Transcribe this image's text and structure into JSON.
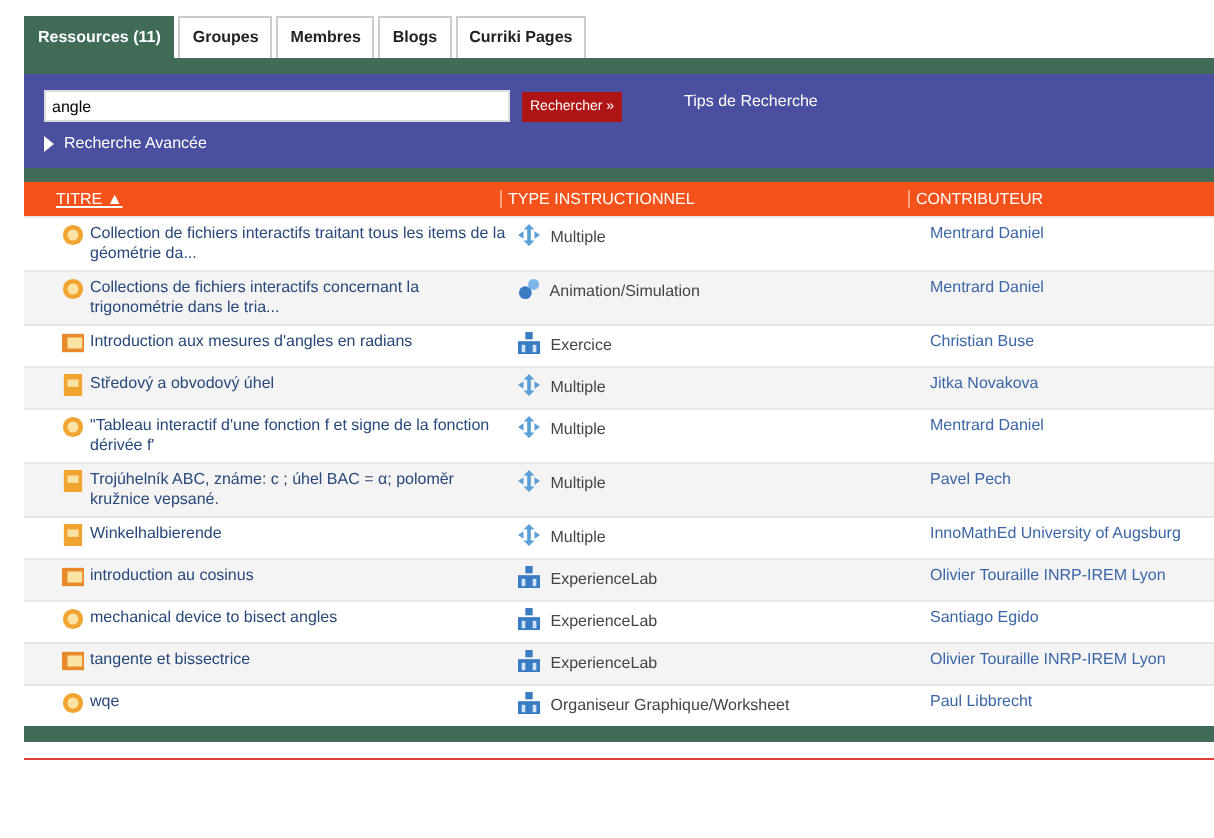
{
  "tabs": [
    {
      "label": "Ressources (11)",
      "selected": true
    },
    {
      "label": "Groupes",
      "selected": false
    },
    {
      "label": "Membres",
      "selected": false
    },
    {
      "label": "Blogs",
      "selected": false
    },
    {
      "label": "Curriki Pages",
      "selected": false
    }
  ],
  "search": {
    "value": "angle",
    "button": "Rechercher »",
    "tips": "Tips de Recherche",
    "advanced": "Recherche Avancée"
  },
  "table": {
    "columns": [
      "TITRE ▲",
      "TYPE INSTRUCTIONNEL",
      "CONTRIBUTEUR"
    ],
    "rows": [
      {
        "kind": "interactive",
        "title": "Collection de fichiers interactifs traitant tous les items de la géométrie da...",
        "type": {
          "kind": "multiple",
          "label": "Multiple"
        },
        "contributor": "Mentrard Daniel"
      },
      {
        "kind": "interactive",
        "title": "Collections de fichiers interactifs concernant la trigonométrie dans le tria...",
        "type": {
          "kind": "animation",
          "label": "Animation/Simulation"
        },
        "contributor": "Mentrard Daniel"
      },
      {
        "kind": "book",
        "title": "Introduction aux mesures d'angles en radians",
        "type": {
          "kind": "blocks",
          "label": "Exercice"
        },
        "contributor": "Christian Buse"
      },
      {
        "kind": "document",
        "title": "Středový a obvodový úhel",
        "type": {
          "kind": "multiple",
          "label": "Multiple"
        },
        "contributor": "Jitka Novakova"
      },
      {
        "kind": "interactive",
        "title": "\"Tableau interactif d'une fonction f et signe de la fonction dérivée f'",
        "type": {
          "kind": "multiple",
          "label": "Multiple"
        },
        "contributor": "Mentrard Daniel"
      },
      {
        "kind": "document",
        "title": "Trojúhelník ABC, známe: c ; úhel BAC = α; poloměr kružnice vepsané.",
        "type": {
          "kind": "multiple",
          "label": "Multiple"
        },
        "contributor": "Pavel Pech"
      },
      {
        "kind": "document",
        "title": "Winkelhalbierende",
        "type": {
          "kind": "multiple",
          "label": "Multiple"
        },
        "contributor": "InnoMathEd University of Augsburg"
      },
      {
        "kind": "book",
        "title": "introduction au cosinus",
        "type": {
          "kind": "blocks",
          "label": "ExperienceLab"
        },
        "contributor": "Olivier Touraille INRP-IREM Lyon"
      },
      {
        "kind": "interactive",
        "title": "mechanical device to bisect angles",
        "type": {
          "kind": "blocks",
          "label": "ExperienceLab"
        },
        "contributor": "Santiago Egido"
      },
      {
        "kind": "book",
        "title": "tangente et bissectrice",
        "type": {
          "kind": "blocks",
          "label": "ExperienceLab"
        },
        "contributor": "Olivier Touraille INRP-IREM Lyon"
      },
      {
        "kind": "interactive",
        "title": "wqe",
        "type": {
          "kind": "blocks",
          "label": "Organiseur Graphique/Worksheet"
        },
        "contributor": "Paul Libbrecht"
      }
    ]
  }
}
